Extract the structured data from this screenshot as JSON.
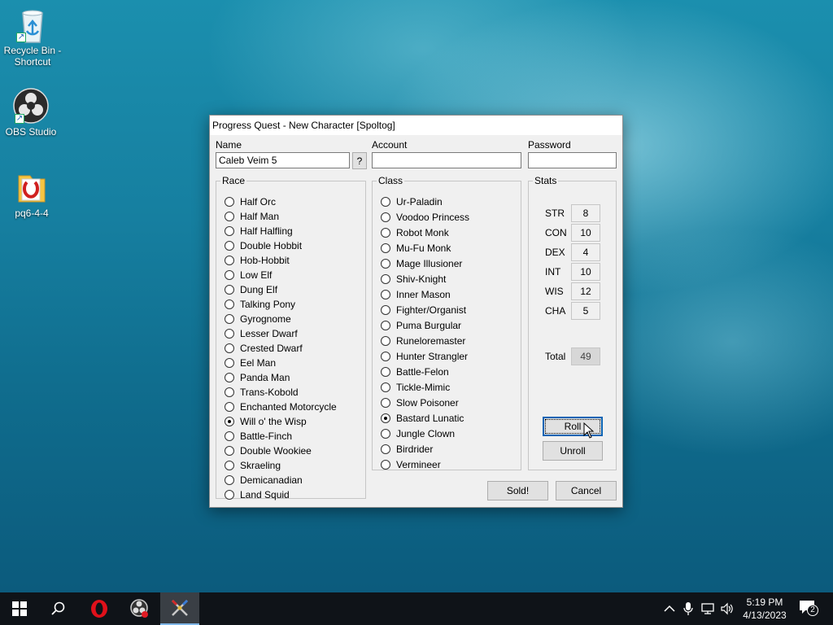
{
  "desktop": {
    "icons": [
      {
        "label_line1": "Recycle Bin -",
        "label_line2": "Shortcut",
        "icon": "recycle-bin-icon"
      },
      {
        "label_line1": "OBS Studio",
        "label_line2": "",
        "icon": "obs-studio-icon"
      },
      {
        "label_line1": "pq6-4-4",
        "label_line2": "",
        "icon": "pq-shortcut-icon"
      }
    ]
  },
  "dialog": {
    "title": "Progress Quest - New Character [Spoltog]",
    "name_label": "Name",
    "name_value": "Caleb Veim 5",
    "random_name_button": "?",
    "account_label": "Account",
    "account_value": "",
    "password_label": "Password",
    "password_value": "",
    "race": {
      "legend": "Race",
      "selected": "Will o' the Wisp",
      "items": [
        "Half Orc",
        "Half Man",
        "Half Halfling",
        "Double Hobbit",
        "Hob-Hobbit",
        "Low Elf",
        "Dung Elf",
        "Talking Pony",
        "Gyrognome",
        "Lesser Dwarf",
        "Crested Dwarf",
        "Eel Man",
        "Panda Man",
        "Trans-Kobold",
        "Enchanted Motorcycle",
        "Will o' the Wisp",
        "Battle-Finch",
        "Double Wookiee",
        "Skraeling",
        "Demicanadian",
        "Land Squid"
      ]
    },
    "class": {
      "legend": "Class",
      "selected": "Bastard Lunatic",
      "items": [
        "Ur-Paladin",
        "Voodoo Princess",
        "Robot Monk",
        "Mu-Fu Monk",
        "Mage Illusioner",
        "Shiv-Knight",
        "Inner Mason",
        "Fighter/Organist",
        "Puma Burgular",
        "Runeloremaster",
        "Hunter Strangler",
        "Battle-Felon",
        "Tickle-Mimic",
        "Slow Poisoner",
        "Bastard Lunatic",
        "Jungle Clown",
        "Birdrider",
        "Vermineer"
      ]
    },
    "stats": {
      "legend": "Stats",
      "items": [
        {
          "name": "STR",
          "value": "8"
        },
        {
          "name": "CON",
          "value": "10"
        },
        {
          "name": "DEX",
          "value": "4"
        },
        {
          "name": "INT",
          "value": "10"
        },
        {
          "name": "WIS",
          "value": "12"
        },
        {
          "name": "CHA",
          "value": "5"
        }
      ],
      "total_label": "Total",
      "total_value": "49",
      "roll_button": "Roll",
      "unroll_button": "Unroll"
    },
    "sold_button": "Sold!",
    "cancel_button": "Cancel"
  },
  "taskbar": {
    "time": "5:19 PM",
    "date": "4/13/2023",
    "notification_count": "2",
    "apps": [
      "windows-start-icon",
      "search-icon",
      "opera-browser-icon",
      "obs-studio-icon",
      "progress-quest-icon"
    ]
  },
  "colors": {
    "focus_blue": "#0a64b4",
    "taskbar": "#0f1318",
    "dialog_bg": "#f0f0f0"
  }
}
